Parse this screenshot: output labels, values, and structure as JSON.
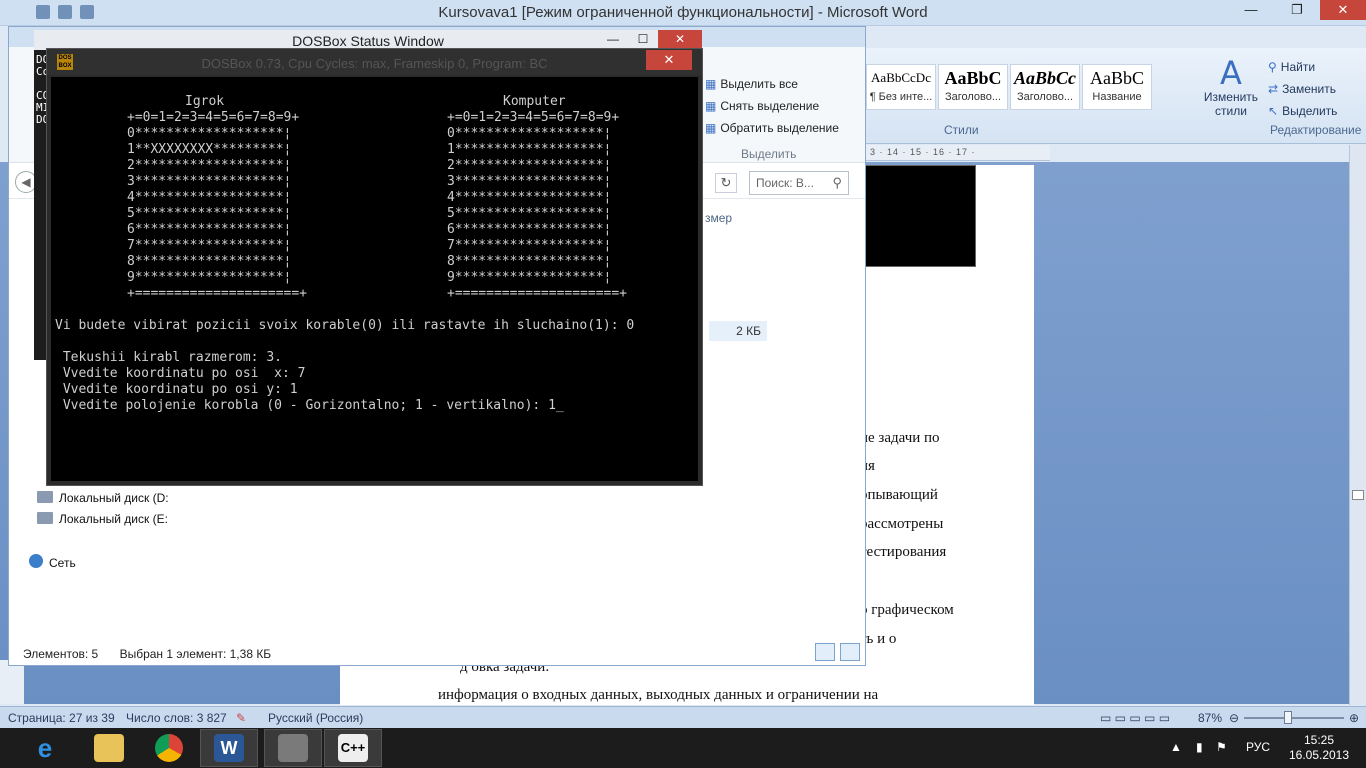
{
  "word": {
    "title": "Kursovava1 [Режим ограниченной функциональности] - Microsoft Word",
    "styles": [
      {
        "preview": "AaBbCcDc",
        "name": "¶ Без инте..."
      },
      {
        "preview": "AaBbC",
        "name": "Заголово..."
      },
      {
        "preview": "AaBbCc",
        "name": "Заголово..."
      },
      {
        "preview": "AaBbC",
        "name": "Название"
      }
    ],
    "styles_group": "Стили",
    "change_styles": "Изменить стили",
    "edit_group": {
      "find": "Найти",
      "replace": "Заменить",
      "select": "Выделить",
      "label": "Редактирование"
    },
    "ruler_text": "3 · 14 · 15 · 16 · 17 ·",
    "doc_lines": [
      "ие задачи по",
      "ия",
      "рпывающий",
      "рассмотрены",
      "тестирования",
      "о графическом",
      "ть и о",
      "д                                                    овка задачи:",
      "информация о входных данных, выходных данных и ограничении  на"
    ],
    "status": {
      "page": "Страница: 27 из 39",
      "words": "Число слов: 3 827",
      "lang": "Русский (Россия)",
      "zoom": "87%"
    }
  },
  "explorer": {
    "select_all": "Выделить все",
    "deselect": "Снять выделение",
    "invert": "Обратить выделение",
    "select_label": "Выделить",
    "search_placeholder": "Поиск: В...",
    "col_size": "змер",
    "file_size": "2 КБ",
    "nav": [
      "Локальный диск (D:",
      "Локальный диск (E:",
      "Сеть"
    ],
    "items_count": "Элементов: 5",
    "selected": "Выбран 1 элемент: 1,38 КБ"
  },
  "status_window": {
    "title": "DOSBox Status Window",
    "side_text": "DOS\nCo\n\nCO\nMI\nDO"
  },
  "dosbox": {
    "title": "DOSBox 0.73, Cpu Cycles:      max, Frameskip  0, Program:      BC",
    "icon_text": "DOS BOX",
    "header_left": "Igrok",
    "header_right": "Komputer",
    "axis": "+=0=1=2=3=4=5=6=7=8=9+",
    "rows_left": [
      "0*******************¦",
      "1**XXXXXXXX*********¦",
      "2*******************¦",
      "3*******************¦",
      "4*******************¦",
      "5*******************¦",
      "6*******************¦",
      "7*******************¦",
      "8*******************¦",
      "9*******************¦"
    ],
    "rows_right": [
      "0*******************¦",
      "1*******************¦",
      "2*******************¦",
      "3*******************¦",
      "4*******************¦",
      "5*******************¦",
      "6*******************¦",
      "7*******************¦",
      "8*******************¦",
      "9*******************¦"
    ],
    "bottom": "+=====================+",
    "prompt1": "Vi budete vibirat pozicii svoix korable(0) ili rastavte ih sluchaino(1): 0",
    "prompt2": " Tekushii kirabl razmerom: 3.",
    "prompt3": " Vvedite koordinatu po osi  x: 7",
    "prompt4": " Vvedite koordinatu po osi y: 1",
    "prompt5": " Vvedite polojenie korobla (0 - Gorizontalno; 1 - vertikalno): 1_"
  },
  "taskbar": {
    "lang": "РУС",
    "time": "15:25",
    "date": "16.05.2013"
  }
}
